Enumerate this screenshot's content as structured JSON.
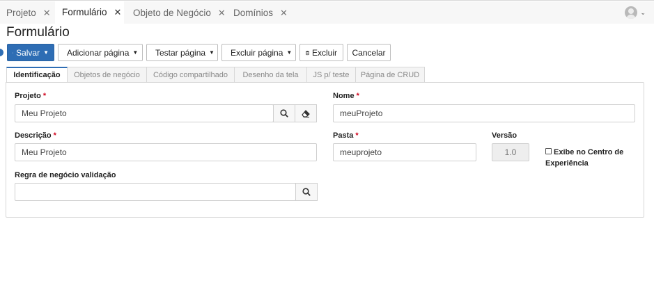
{
  "tabs": [
    {
      "label": "Projeto",
      "close": "✕"
    },
    {
      "label": "Formulário",
      "close": "✕"
    },
    {
      "label": "Objeto de Negócio",
      "close": "✕"
    },
    {
      "label": "Domínios",
      "close": "✕"
    }
  ],
  "user": {
    "caret": "⌄"
  },
  "page": {
    "title": "Formulário"
  },
  "toolbar": {
    "save": "Salvar",
    "add_page": "Adicionar página",
    "test_page": "Testar página",
    "delete_page": "Excluir página",
    "delete": "Excluir",
    "cancel": "Cancelar"
  },
  "section_tabs": [
    "Identificação",
    "Objetos de negócio",
    "Código compartilhado",
    "Desenho da tela",
    "JS p/ teste",
    "Página de CRUD"
  ],
  "form": {
    "projeto": {
      "label": "Projeto",
      "value": "Meu Projeto",
      "required": "*"
    },
    "nome": {
      "label": "Nome",
      "value": "meuProjeto",
      "required": "*"
    },
    "descricao": {
      "label": "Descrição",
      "value": "Meu Projeto",
      "required": "*"
    },
    "pasta": {
      "label": "Pasta",
      "value": "meuprojeto",
      "required": "*"
    },
    "versao": {
      "label": "Versão",
      "value": "1.0"
    },
    "exibe": {
      "label": "Exibe no Centro de Experiência",
      "checked": false
    },
    "regra": {
      "label": "Regra de negócio validação",
      "value": ""
    }
  },
  "colors": {
    "primary": "#2e6db4",
    "required": "#d0021b"
  }
}
